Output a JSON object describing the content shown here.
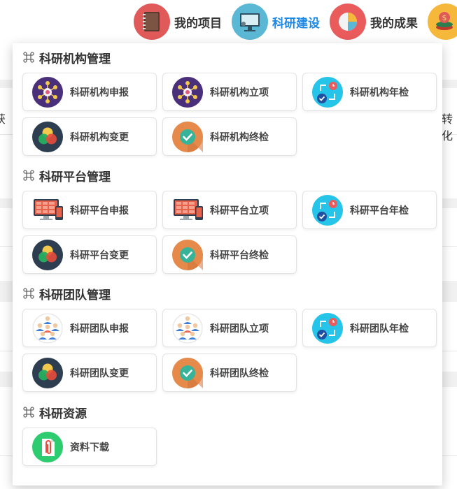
{
  "topnav": {
    "items": [
      {
        "label": "我的项目",
        "icon": "notebook-icon",
        "color": "#e05a5a",
        "active": false
      },
      {
        "label": "科研建设",
        "icon": "monitor-icon",
        "color": "#5bb8d4",
        "active": true
      },
      {
        "label": "我的成果",
        "icon": "pie-chart-icon",
        "color": "#ea5b5b",
        "active": false
      },
      {
        "label": "",
        "icon": "coins-icon",
        "color": "#f5b83b",
        "active": false
      }
    ]
  },
  "background": {
    "left_text": "获",
    "right_text": "转化"
  },
  "menu": {
    "sections": [
      {
        "title": "科研机构管理",
        "items": [
          {
            "label": "科研机构申报",
            "icon": "network-icon"
          },
          {
            "label": "科研机构立项",
            "icon": "network-icon"
          },
          {
            "label": "科研机构年检",
            "icon": "annual-check-icon"
          },
          {
            "label": "科研机构变更",
            "icon": "venn-circles-icon"
          },
          {
            "label": "科研机构终检",
            "icon": "checkmark-circle-icon"
          }
        ]
      },
      {
        "title": "科研平台管理",
        "items": [
          {
            "label": "科研平台申报",
            "icon": "devices-icon"
          },
          {
            "label": "科研平台立项",
            "icon": "devices-icon"
          },
          {
            "label": "科研平台年检",
            "icon": "annual-check-icon"
          },
          {
            "label": "科研平台变更",
            "icon": "venn-circles-icon"
          },
          {
            "label": "科研平台终检",
            "icon": "checkmark-circle-icon"
          }
        ]
      },
      {
        "title": "科研团队管理",
        "items": [
          {
            "label": "科研团队申报",
            "icon": "team-icon"
          },
          {
            "label": "科研团队立项",
            "icon": "team-icon"
          },
          {
            "label": "科研团队年检",
            "icon": "annual-check-icon"
          },
          {
            "label": "科研团队变更",
            "icon": "venn-circles-icon"
          },
          {
            "label": "科研团队终检",
            "icon": "checkmark-circle-icon"
          }
        ]
      },
      {
        "title": "科研资源",
        "items": [
          {
            "label": "资料下载",
            "icon": "paperclip-document-icon"
          }
        ]
      }
    ]
  }
}
